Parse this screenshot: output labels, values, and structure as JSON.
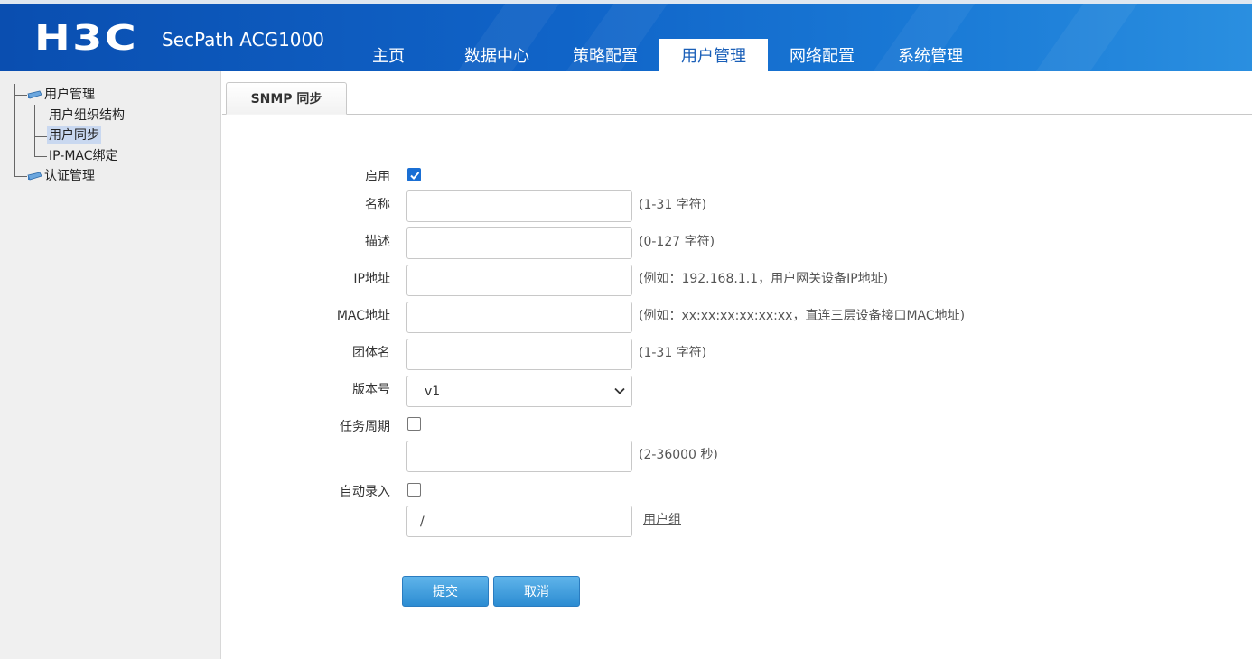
{
  "header": {
    "logo": "H3C",
    "product": "SecPath ACG1000",
    "tabs": [
      {
        "label": "主页"
      },
      {
        "label": "数据中心"
      },
      {
        "label": "策略配置"
      },
      {
        "label": "用户管理"
      },
      {
        "label": "网络配置"
      },
      {
        "label": "系统管理"
      }
    ],
    "active_tab": "用户管理"
  },
  "sidebar": {
    "tree": {
      "root1": "用户管理",
      "children": [
        "用户组织结构",
        "用户同步",
        "IP-MAC绑定"
      ],
      "selected": "用户同步",
      "root2": "认证管理"
    }
  },
  "main": {
    "tab_label": "SNMP 同步",
    "form": {
      "enable": {
        "label": "启用",
        "checked": true
      },
      "name": {
        "label": "名称",
        "value": "",
        "hint": "(1-31 字符)"
      },
      "description": {
        "label": "描述",
        "value": "",
        "hint": "(0-127 字符)"
      },
      "ip": {
        "label": "IP地址",
        "value": "",
        "hint": "(例如：192.168.1.1，用户网关设备IP地址)"
      },
      "mac": {
        "label": "MAC地址",
        "value": "",
        "hint": "(例如：xx:xx:xx:xx:xx:xx，直连三层设备接口MAC地址)"
      },
      "community": {
        "label": "团体名",
        "value": "",
        "hint": "(1-31 字符)"
      },
      "version": {
        "label": "版本号",
        "selected": "v1"
      },
      "task_period": {
        "label": "任务周期",
        "checked": false,
        "value": "",
        "hint": "(2-36000 秒)"
      },
      "auto_enroll": {
        "label": "自动录入",
        "checked": false,
        "value": "/",
        "link": "用户组"
      }
    },
    "buttons": {
      "submit": "提交",
      "cancel": "取消"
    }
  },
  "colors": {
    "header_start": "#0a4eb0",
    "header_end": "#2a8fe0",
    "checkbox_checked": "#1a6fd4",
    "button": "#2c8cd2"
  }
}
